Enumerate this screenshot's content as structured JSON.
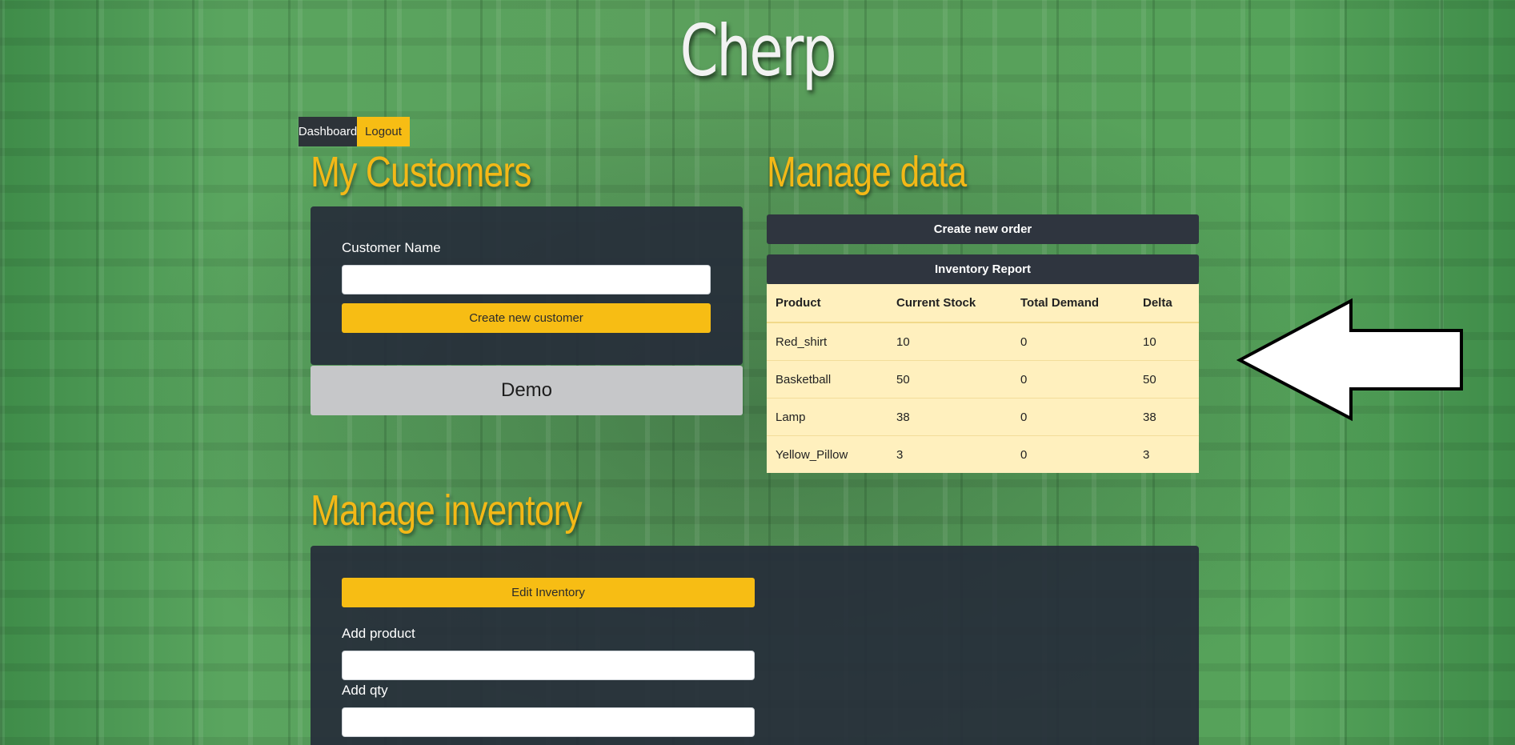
{
  "app": {
    "title": "Cherp"
  },
  "nav": {
    "dashboard": "Dashboard",
    "logout": "Logout"
  },
  "customers": {
    "heading": "My Customers",
    "name_label": "Customer Name",
    "name_value": "",
    "create_button": "Create new customer",
    "items": [
      "Demo"
    ]
  },
  "manage_data": {
    "heading": "Manage data",
    "create_order_button": "Create new order",
    "inventory_report_button": "Inventory Report",
    "table": {
      "headers": [
        "Product",
        "Current Stock",
        "Total Demand",
        "Delta"
      ],
      "rows": [
        [
          "Red_shirt",
          "10",
          "0",
          "10"
        ],
        [
          "Basketball",
          "50",
          "0",
          "50"
        ],
        [
          "Lamp",
          "38",
          "0",
          "38"
        ],
        [
          "Yellow_Pillow",
          "3",
          "0",
          "3"
        ]
      ]
    }
  },
  "inventory": {
    "heading": "Manage inventory",
    "edit_button": "Edit Inventory",
    "add_product_label": "Add product",
    "add_product_value": "",
    "add_qty_label": "Add qty",
    "add_qty_value": ""
  },
  "colors": {
    "accent": "#f7bd14",
    "panel": "#262c3a",
    "table_bg": "#fff0be",
    "background": "#4f9a55"
  },
  "icons": {
    "pointer": "left-arrow-icon"
  }
}
